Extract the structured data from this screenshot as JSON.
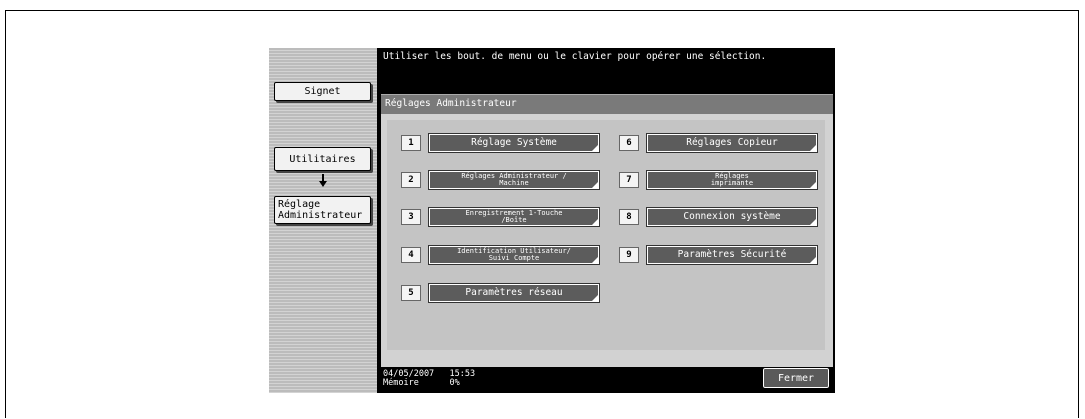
{
  "topbar": {
    "message": "Utiliser les bout. de menu ou le clavier pour opérer une sélection."
  },
  "sidebar": {
    "signet": "Signet",
    "utilitaires": "Utilitaires",
    "reglage_line1": "Réglage",
    "reglage_line2": "Administrateur",
    "arrow_icon": "arrow-down-icon"
  },
  "window": {
    "title": "Réglages Administrateur"
  },
  "menu": {
    "left": [
      {
        "num": "1",
        "line1": "Réglage Système",
        "line2": ""
      },
      {
        "num": "2",
        "line1": "Réglages Administrateur /",
        "line2": "Machine"
      },
      {
        "num": "3",
        "line1": "Enregistrement 1-Touche",
        "line2": "/Boîte"
      },
      {
        "num": "4",
        "line1": "Identification Utilisateur/",
        "line2": "Suivi Compte"
      },
      {
        "num": "5",
        "line1": "Paramètres réseau",
        "line2": ""
      }
    ],
    "right": [
      {
        "num": "6",
        "line1": "Réglages Copieur",
        "line2": ""
      },
      {
        "num": "7",
        "line1": "Réglages",
        "line2": "imprimante"
      },
      {
        "num": "8",
        "line1": "Connexion système",
        "line2": ""
      },
      {
        "num": "9",
        "line1": "Paramètres Sécurité",
        "line2": ""
      }
    ]
  },
  "status": {
    "date": "04/05/2007",
    "time": "15:53",
    "memory_label": "Mémoire",
    "memory_value": "0%"
  },
  "close_button": "Fermer"
}
